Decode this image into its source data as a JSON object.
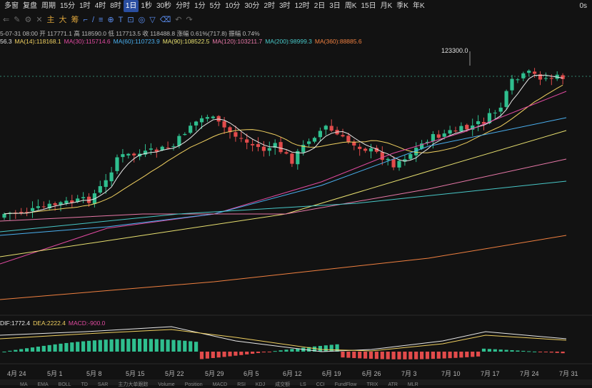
{
  "toolbar": {
    "items": [
      "多窗",
      "复盘",
      "周期",
      "15分",
      "1时",
      "4时",
      "8时",
      "1日",
      "1秒",
      "30秒",
      "分时",
      "1分",
      "5分",
      "10分",
      "30分",
      "2时",
      "3时",
      "12时",
      "2日",
      "3日",
      "周K",
      "15日",
      "月K",
      "季K",
      "年K"
    ],
    "active_index": 7,
    "right": "0s"
  },
  "drawing_tools": [
    "主",
    "大",
    "筹"
  ],
  "info_line": "5-07-31 08:00  开 117771.1  高 118590.0  低 117713.5  收 118488.8  涨幅 0.61%(717.8)  振幅 0.74%",
  "ma_legend": [
    {
      "label": "56.3",
      "color": "#e0e0e0"
    },
    {
      "label": "MA(14):118168.1",
      "color": "#f0d060"
    },
    {
      "label": "MA(30):115714.6",
      "color": "#e04aa0"
    },
    {
      "label": "MA(60):110723.9",
      "color": "#4ab0f0"
    },
    {
      "label": "MA(90):108522.5",
      "color": "#e8e070"
    },
    {
      "label": "MA(120):103211.7",
      "color": "#e878a8"
    },
    {
      "label": "MA(200):98999.3",
      "color": "#48c8c8"
    },
    {
      "label": "MA(360):88885.6",
      "color": "#f08040"
    }
  ],
  "macd_legend": [
    {
      "label": "DIF:1772.4",
      "color": "#e8e8e8"
    },
    {
      "label": "DEA:2222.4",
      "color": "#f0d060"
    },
    {
      "label": "MACD:-900.0",
      "color": "#e04aa0"
    }
  ],
  "annotation": "123300.0",
  "x_labels": [
    "4月 24",
    "5月 1",
    "5月 8",
    "5月 15",
    "5月 22",
    "5月 29",
    "6月 5",
    "6月 12",
    "6月 19",
    "6月 26",
    "7月 3",
    "7月 10",
    "7月 17",
    "7月 24",
    "7月 31"
  ],
  "colors": {
    "up": "#2fbf8f",
    "down": "#e24b4b",
    "bg": "#121212"
  },
  "chart_data": {
    "type": "candlestick",
    "annotation_high": 123300.0,
    "last_close": 118488.8,
    "legend": [
      "MA(14)",
      "MA(30)",
      "MA(60)",
      "MA(90)",
      "MA(120)",
      "MA(200)",
      "MA(360)"
    ]
  },
  "bottom": [
    "MA",
    "EMA",
    "BOLL",
    "TD",
    "SAR",
    "主力大单跟踪",
    "Volume",
    "Position",
    "MACD",
    "RSI",
    "KDJ",
    "成交额",
    "LS",
    "CCI",
    "FundFlow",
    "TRIX",
    "ATR",
    "MLR"
  ]
}
